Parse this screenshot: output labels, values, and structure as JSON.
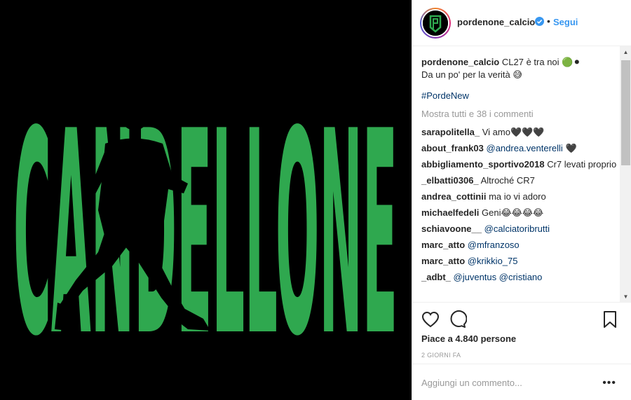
{
  "media": {
    "poster_text": "CANDELLONE",
    "colors": {
      "background": "#000000",
      "letters": "#2fa84f",
      "silhouette": "#000000"
    }
  },
  "post": {
    "username": "pordenone_calcio",
    "follow_label": "Segui",
    "separator": "•",
    "caption_line1": "CL27 è tra noi 🟢⚫",
    "caption_line2": "Da un po' per la verità 😅",
    "hashtag": "#PordeNew",
    "load_more": "Mostra tutti e 38 i commenti",
    "likes": "Piace a 4.840 persone",
    "date": "2 GIORNI FA",
    "comment_placeholder": "Aggiungi un commento...",
    "more_label": "•••"
  },
  "comments": [
    {
      "user": "sarapolitella_",
      "text": "Vi amo🖤🖤🖤",
      "mentions": []
    },
    {
      "user": "about_frank03",
      "text": "🖤",
      "mentions": [
        "@andrea.venterelli"
      ]
    },
    {
      "user": "abbigliamento_sportivo2018",
      "text": "Cr7 levati proprio",
      "mentions": []
    },
    {
      "user": "_elbatti0306_",
      "text": "Altroché CR7",
      "mentions": []
    },
    {
      "user": "andrea_cottinii",
      "text": "ma io vi adoro",
      "mentions": []
    },
    {
      "user": "michaelfedeli",
      "text": "Geni😂😂😂😂",
      "mentions": []
    },
    {
      "user": "schiavoone__",
      "text": "",
      "mentions": [
        "@calciatoribrutti"
      ]
    },
    {
      "user": "marc_atto",
      "text": "",
      "mentions": [
        "@mfranzoso"
      ]
    },
    {
      "user": "marc_atto",
      "text": "",
      "mentions": [
        "@krikkio_75"
      ]
    },
    {
      "user": "_adbt_",
      "text": "",
      "mentions": [
        "@juventus",
        "@cristiano"
      ]
    }
  ],
  "icons": [
    "verified-badge-icon",
    "heart-icon",
    "comment-icon",
    "bookmark-icon",
    "scroll-up-arrow-icon",
    "scroll-down-arrow-icon"
  ],
  "theme": {
    "link": "#3897f0",
    "mention": "#003569",
    "muted": "#999999",
    "border": "#efefef"
  }
}
